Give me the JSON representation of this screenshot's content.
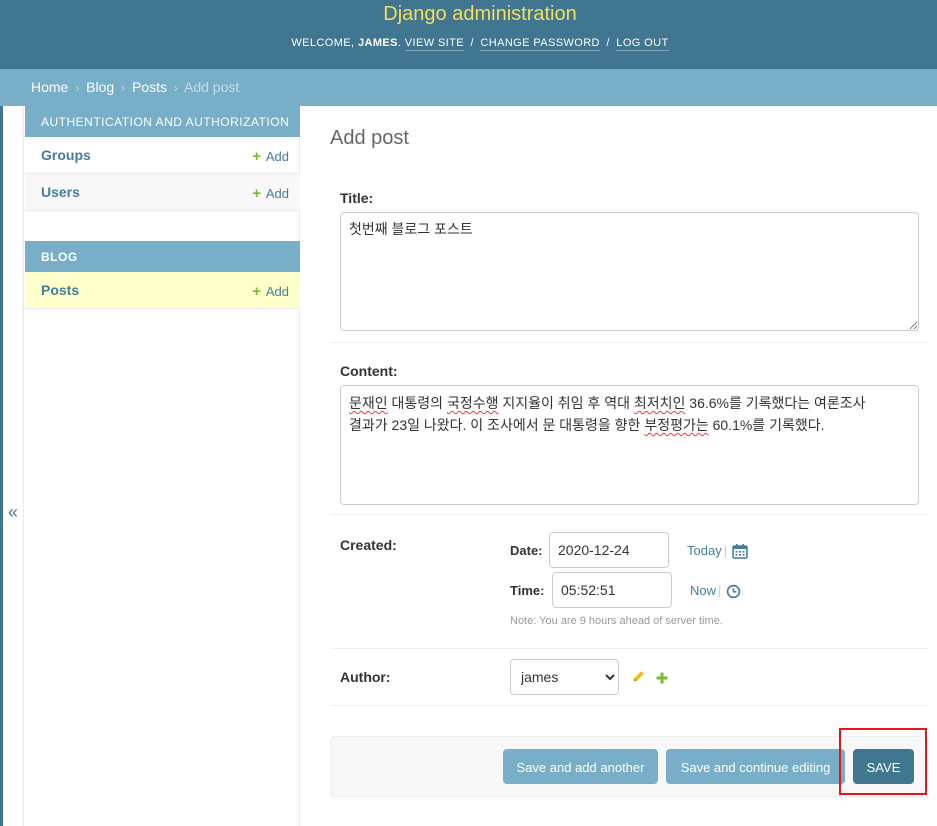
{
  "header": {
    "site_name": "Django administration",
    "welcome": "Welcome,",
    "username": "james",
    "view_site": "View site",
    "change_password": "Change password",
    "log_out": "Log out",
    "sep1": "/",
    "sep2": "/"
  },
  "breadcrumbs": {
    "home": "Home",
    "blog": "Blog",
    "posts": "Posts",
    "current": "Add post",
    "arrow": "›"
  },
  "sidebar": {
    "collapse_glyph": "«",
    "modules": [
      {
        "caption": "Authentication and Authorization",
        "models": [
          {
            "name": "Groups",
            "add": "Add"
          },
          {
            "name": "Users",
            "add": "Add"
          }
        ]
      },
      {
        "caption": "Blog",
        "models": [
          {
            "name": "Posts",
            "add": "Add"
          }
        ]
      }
    ],
    "plus_glyph": "+"
  },
  "content": {
    "title": "Add post",
    "fields": {
      "title_label": "Title:",
      "title_value": "첫번째 블로그 포스트",
      "content_label": "Content:",
      "content_line1_a": "문재인",
      "content_line1_b": " 대통령의 ",
      "content_line1_c": "국정수행",
      "content_line1_d": " 지지율이 취임 후 역대 ",
      "content_line1_e": "최저치인",
      "content_line1_f": " 36.6%를 기록했다는 여론조사",
      "content_line2_a": "결과가 23일 나왔다. 이 조사에서 문 대통령을 향한 ",
      "content_line2_b": "부정평가는",
      "content_line2_c": " 60.1%를 기록했다.",
      "created_label": "Created:",
      "date_label": "Date:",
      "date_value": "2020-12-24",
      "today": "Today",
      "time_label": "Time:",
      "time_value": "05:52:51",
      "now": "Now",
      "shortcut_sep": "|",
      "timezone_note": "Note: You are 9 hours ahead of server time.",
      "author_label": "Author:",
      "author_value": "james",
      "author_options": [
        "james"
      ]
    },
    "buttons": {
      "save_add_another": "Save and add another",
      "save_continue": "Save and continue editing",
      "save": "SAVE"
    }
  },
  "colors": {
    "header_bg": "#417690",
    "breadcrumb_bg": "#79aec8",
    "site_name": "#f5dd5d",
    "link": "#447e9b",
    "add_plus": "#70bf2b",
    "active_row": "#ffffcc",
    "highlight_box": "#e8141a"
  },
  "icons": [
    "calendar-icon",
    "clock-icon",
    "pencil-icon",
    "plus-icon",
    "collapse-icon"
  ]
}
